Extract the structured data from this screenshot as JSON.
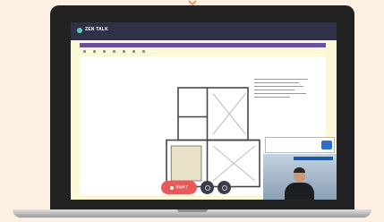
{
  "app": {
    "logo_text": "ZEN TALK",
    "header_links": [
      "",
      "",
      "",
      ""
    ]
  },
  "controls": {
    "record_label": "録画終了"
  },
  "colors": {
    "background": "#fdf0e3",
    "screen": "#fbf8d8",
    "header": "#2e3147",
    "accent": "#6c4fa3",
    "record": "#e85a5a",
    "send": "#2f6fc9"
  },
  "icons": [
    "chevron-down-icon",
    "record-icon",
    "microphone-icon",
    "camera-icon",
    "send-icon"
  ]
}
